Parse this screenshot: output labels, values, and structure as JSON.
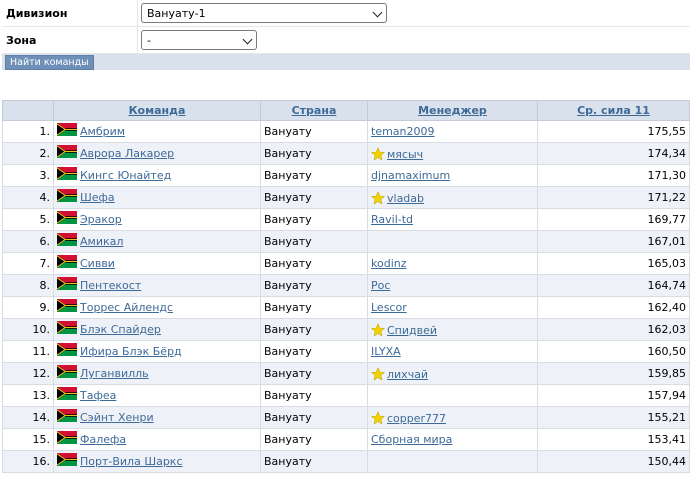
{
  "filters": {
    "division_label": "Дивизион",
    "division_value": "Вануату-1",
    "zone_label": "Зона",
    "zone_value": "-",
    "find_button": "Найти команды"
  },
  "table": {
    "headers": [
      "Команда",
      "Страна",
      "Менеджер",
      "Ср. сила 11"
    ],
    "rows": [
      {
        "rank": "1.",
        "team": "Амбрим",
        "country": "Вануату",
        "manager": "teman2009",
        "star": false,
        "strength": "175,55"
      },
      {
        "rank": "2.",
        "team": "Аврора Лакарер",
        "country": "Вануату",
        "manager": "мясыч",
        "star": true,
        "strength": "174,34"
      },
      {
        "rank": "3.",
        "team": "Кингс Юнайтед",
        "country": "Вануату",
        "manager": "djnamaximum",
        "star": false,
        "strength": "171,30"
      },
      {
        "rank": "4.",
        "team": "Шефа",
        "country": "Вануату",
        "manager": "vladab",
        "star": true,
        "strength": "171,22"
      },
      {
        "rank": "5.",
        "team": "Эракор",
        "country": "Вануату",
        "manager": "Ravil-td",
        "star": false,
        "strength": "169,77"
      },
      {
        "rank": "6.",
        "team": "Амикал",
        "country": "Вануату",
        "manager": "",
        "star": false,
        "strength": "167,01"
      },
      {
        "rank": "7.",
        "team": "Сивви",
        "country": "Вануату",
        "manager": "kodinz",
        "star": false,
        "strength": "165,03"
      },
      {
        "rank": "8.",
        "team": "Пентекост",
        "country": "Вануату",
        "manager": "Рос",
        "star": false,
        "strength": "164,74"
      },
      {
        "rank": "9.",
        "team": "Торрес Айлендс",
        "country": "Вануату",
        "manager": "Lescor",
        "star": false,
        "strength": "162,40"
      },
      {
        "rank": "10.",
        "team": "Блэк Спайдер",
        "country": "Вануату",
        "manager": "Спидвей",
        "star": true,
        "strength": "162,03"
      },
      {
        "rank": "11.",
        "team": "Ифира Блэк Бёрд",
        "country": "Вануату",
        "manager": "ILYXA",
        "star": false,
        "strength": "160,50"
      },
      {
        "rank": "12.",
        "team": "Луганвилль",
        "country": "Вануату",
        "manager": "лихчай",
        "star": true,
        "strength": "159,85"
      },
      {
        "rank": "13.",
        "team": "Тафеа",
        "country": "Вануату",
        "manager": "",
        "star": false,
        "strength": "157,94"
      },
      {
        "rank": "14.",
        "team": "Сэйнт Хенри",
        "country": "Вануату",
        "manager": "copper777",
        "star": true,
        "strength": "155,21"
      },
      {
        "rank": "15.",
        "team": "Фалефа",
        "country": "Вануату",
        "manager": "Сборная мира",
        "star": false,
        "strength": "153,41"
      },
      {
        "rank": "16.",
        "team": "Порт-Вила Шаркс",
        "country": "Вануату",
        "manager": "",
        "star": false,
        "strength": "150,44"
      }
    ]
  },
  "colors": {
    "header_bg": "#d9e2ec",
    "link": "#3e6a97",
    "even_row": "#eef2f8",
    "star": "#f2d200"
  },
  "icons": {
    "flag": "vanuatu-flag-icon",
    "star": "star-icon"
  }
}
